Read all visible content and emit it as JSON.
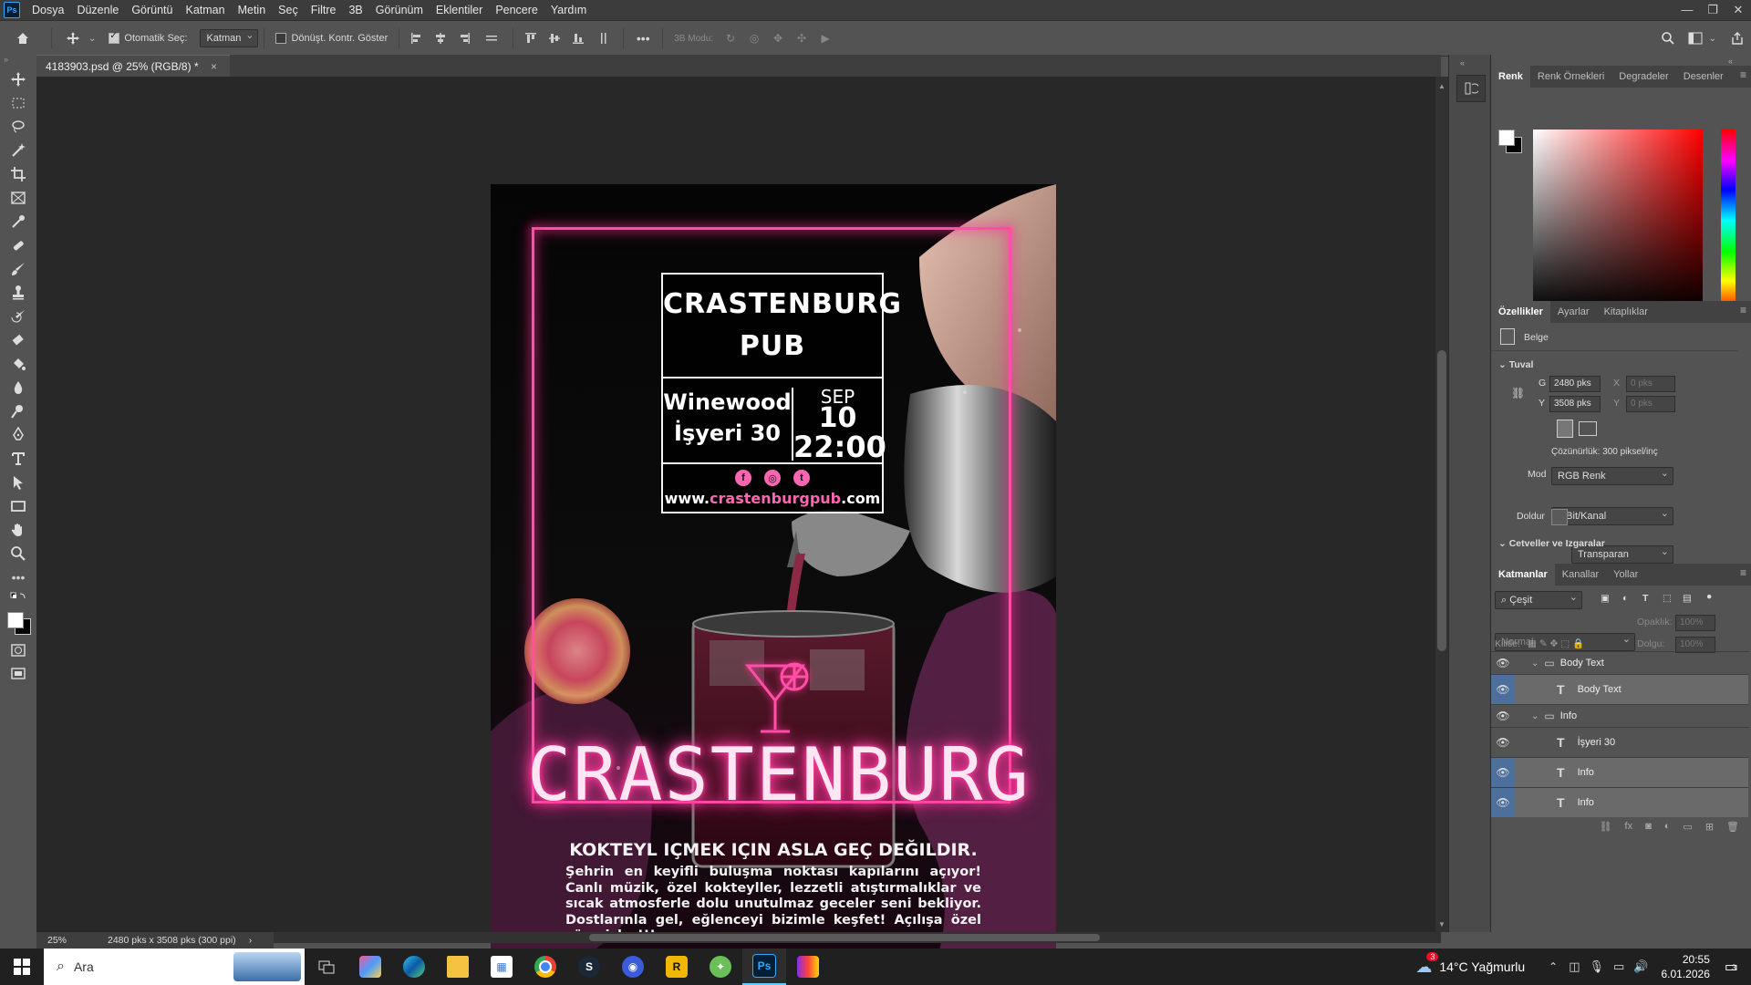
{
  "menubar": {
    "app_logo": "Ps",
    "items": [
      "Dosya",
      "Düzenle",
      "Görüntü",
      "Katman",
      "Metin",
      "Seç",
      "Filtre",
      "3B",
      "Görünüm",
      "Eklentiler",
      "Pencere",
      "Yardım"
    ],
    "window_controls": [
      "—",
      "❐",
      "✕"
    ]
  },
  "options": {
    "auto_select_label": "Otomatik Seç:",
    "auto_select_checked": true,
    "auto_select_target": "Katman",
    "transform_label": "Dönüşt. Kontr. Göster",
    "transform_checked": false,
    "mode_3d_label": "3B Modu:",
    "more": "•••"
  },
  "document": {
    "tab_title": "4183903.psd @ 25% (RGB/8) *",
    "tab_close": "×"
  },
  "artwork": {
    "pub_title_line1": "CRASTENBURG",
    "pub_title_line2": "PUB",
    "venue_line1": "Winewood",
    "venue_line2": "İşyeri 30",
    "date_month": "SEP",
    "date_day": "10",
    "date_time": "22:00",
    "social_icons": [
      "facebook-icon",
      "instagram-icon",
      "twitter-icon"
    ],
    "website_prefix": "www.",
    "website_name": "crastenburgpub",
    "website_suffix": ".com",
    "neon_word": "CRASTENBURG",
    "tagline": "KOKTEYL IÇMEK IÇIN ASLA GEÇ DEĞILDIR.",
    "body_text": "Şehrin en keyifli buluşma noktası kapılarını açıyor! Canlı müzik, özel kokteyller, lezzetli atıştırmalıklar ve sıcak atmosferle dolu unutulmaz geceler seni bekliyor. Dostlarınla gel, eğlenceyi bizimle keşfet! Açılışa özel sürprizler!!!",
    "neon_color": "#ff4fa7"
  },
  "status": {
    "zoom": "25%",
    "doc_info": "2480 pks x 3508 pks (300 ppi)",
    "arrow": "›"
  },
  "color_panel": {
    "tabs": [
      "Renk",
      "Renk Örnekleri",
      "Degradeler",
      "Desenler"
    ],
    "active_tab": "Renk",
    "fg_color": "#ffffff",
    "bg_color": "#000000"
  },
  "properties_panel": {
    "tabs": [
      "Özellikler",
      "Ayarlar",
      "Kitaplıklar"
    ],
    "active_tab": "Özellikler",
    "doc_label": "Belge",
    "canvas_section": "Tuval",
    "width_label": "G",
    "width_value": "2480 pks",
    "height_label": "Y",
    "height_value": "3508 pks",
    "x_label": "X",
    "x_value": "0 pks",
    "y_label": "Y",
    "y_value": "0 pks",
    "resolution": "Çözünürlük: 300 piksel/inç",
    "mode_label": "Mod",
    "mode_value": "RGB Renk",
    "bit_value": "8 Bit/Kanal",
    "fill_label": "Doldur",
    "fill_value": "Transparan",
    "rulers_section": "Cetveller ve Izgaralar"
  },
  "layers_panel": {
    "tabs": [
      "Katmanlar",
      "Kanallar",
      "Yollar"
    ],
    "active_tab": "Katmanlar",
    "filter_kind": "Çeşit",
    "blend_mode": "Normal",
    "opacity_label": "Opaklık:",
    "opacity_value": "100%",
    "lock_label": "Kilitle:",
    "fill_label": "Dolgu:",
    "fill_value": "100%",
    "layers": [
      {
        "name": "Body Text",
        "type": "group"
      },
      {
        "name": "Body Text",
        "type": "text"
      },
      {
        "name": "Info",
        "type": "group"
      },
      {
        "name": "İşyeri 30",
        "type": "text"
      },
      {
        "name": "Info",
        "type": "text"
      },
      {
        "name": "Info",
        "type": "text"
      }
    ]
  },
  "taskbar": {
    "search_placeholder": "Ara",
    "weather": "14°C  Yağmurlu",
    "weather_badge": "3",
    "time": "20:55",
    "date": "6.01.2026",
    "notification_count": "3"
  }
}
